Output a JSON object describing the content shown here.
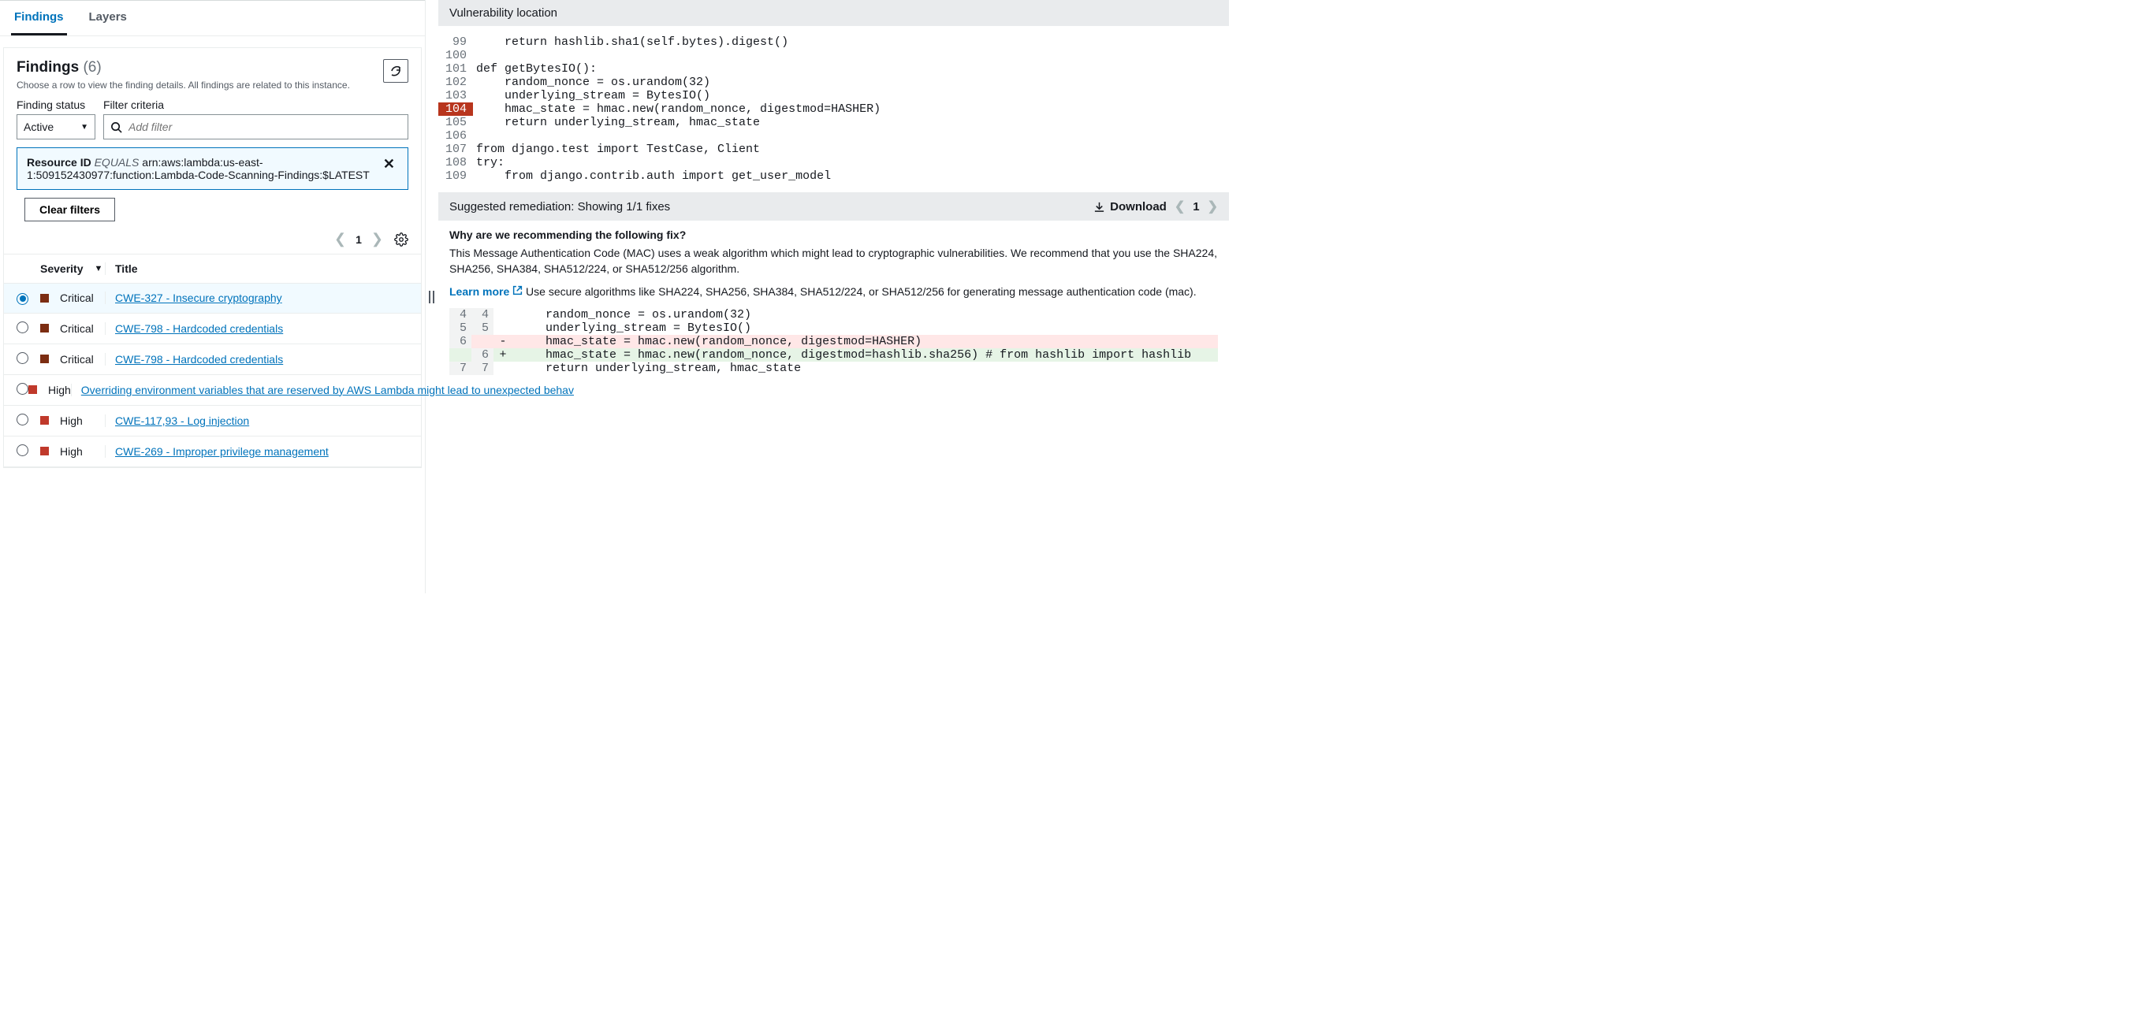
{
  "tabs": {
    "findings": "Findings",
    "layers": "Layers"
  },
  "panel": {
    "title": "Findings",
    "count": "(6)",
    "subtitle": "Choose a row to view the finding details. All findings are related to this instance.",
    "status_label": "Finding status",
    "status_value": "Active",
    "filter_label": "Filter criteria",
    "filter_placeholder": "Add filter",
    "chip_label": "Resource ID",
    "chip_op": "EQUALS",
    "chip_value": "arn:aws:lambda:us-east-1:509152430977:function:Lambda-Code-Scanning-Findings:$LATEST",
    "clear": "Clear filters",
    "page": "1"
  },
  "columns": {
    "severity": "Severity",
    "title": "Title"
  },
  "rows": [
    {
      "sev": "Critical",
      "sev_class": "sev-critical",
      "title": "CWE-327 - Insecure cryptography",
      "selected": true
    },
    {
      "sev": "Critical",
      "sev_class": "sev-critical",
      "title": "CWE-798 - Hardcoded credentials",
      "selected": false
    },
    {
      "sev": "Critical",
      "sev_class": "sev-critical",
      "title": "CWE-798 - Hardcoded credentials",
      "selected": false
    },
    {
      "sev": "High",
      "sev_class": "sev-high",
      "title": "Overriding environment variables that are reserved by AWS Lambda might lead to unexpected behav",
      "selected": false
    },
    {
      "sev": "High",
      "sev_class": "sev-high",
      "title": "CWE-117,93 - Log injection",
      "selected": false
    },
    {
      "sev": "High",
      "sev_class": "sev-high",
      "title": "CWE-269 - Improper privilege management",
      "selected": false
    }
  ],
  "vuln": {
    "heading": "Vulnerability location",
    "lines": [
      {
        "n": "99",
        "hl": false,
        "code": "    return hashlib.sha1(self.bytes).digest()"
      },
      {
        "n": "100",
        "hl": false,
        "code": ""
      },
      {
        "n": "101",
        "hl": false,
        "code": "def getBytesIO():"
      },
      {
        "n": "102",
        "hl": false,
        "code": "    random_nonce = os.urandom(32)"
      },
      {
        "n": "103",
        "hl": false,
        "code": "    underlying_stream = BytesIO()"
      },
      {
        "n": "104",
        "hl": true,
        "code": "    hmac_state = hmac.new(random_nonce, digestmod=HASHER)"
      },
      {
        "n": "105",
        "hl": false,
        "code": "    return underlying_stream, hmac_state"
      },
      {
        "n": "106",
        "hl": false,
        "code": ""
      },
      {
        "n": "107",
        "hl": false,
        "code": "from django.test import TestCase, Client"
      },
      {
        "n": "108",
        "hl": false,
        "code": "try:"
      },
      {
        "n": "109",
        "hl": false,
        "code": "    from django.contrib.auth import get_user_model"
      }
    ]
  },
  "rem": {
    "heading": "Suggested remediation: Showing 1/1 fixes",
    "download": "Download",
    "page": "1",
    "question": "Why are we recommending the following fix?",
    "explain": "This Message Authentication Code (MAC) uses a weak algorithm which might lead to cryptographic vulnerabilities. We recommend that you use the SHA224, SHA256, SHA384, SHA512/224, or SHA512/256 algorithm.",
    "learn": "Learn more",
    "tail": "Use secure algorithms like SHA224, SHA256, SHA384, SHA512/224, or SHA512/256 for generating message authentication code (mac).",
    "diff": [
      {
        "old": "4",
        "new": "4",
        "sign": "",
        "code": "    random_nonce = os.urandom(32)",
        "cls": ""
      },
      {
        "old": "5",
        "new": "5",
        "sign": "",
        "code": "    underlying_stream = BytesIO()",
        "cls": ""
      },
      {
        "old": "6",
        "new": "",
        "sign": "-",
        "code": "    hmac_state = hmac.new(random_nonce, digestmod=HASHER)",
        "cls": "drow-del"
      },
      {
        "old": "",
        "new": "6",
        "sign": "+",
        "code": "    hmac_state = hmac.new(random_nonce, digestmod=hashlib.sha256) # from hashlib import hashlib",
        "cls": "drow-add"
      },
      {
        "old": "7",
        "new": "7",
        "sign": "",
        "code": "    return underlying_stream, hmac_state",
        "cls": ""
      }
    ]
  }
}
